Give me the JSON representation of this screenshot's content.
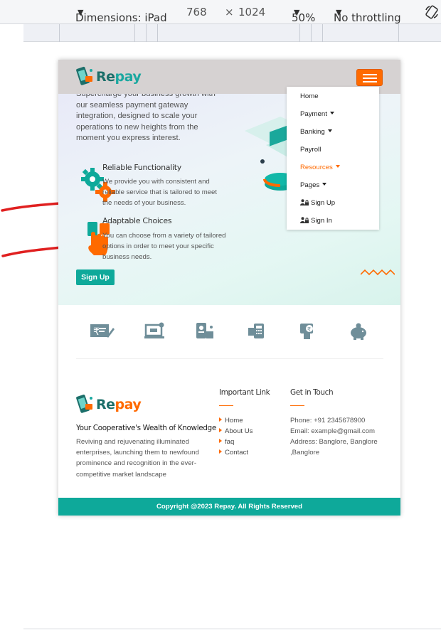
{
  "devtools": {
    "device_label": "Dimensions: iPad",
    "width": "768",
    "times": "×",
    "height": "1024",
    "zoom": "50%",
    "throttling": "No throttling"
  },
  "site": {
    "brand_prefix": "Re",
    "brand_suffix": "pay",
    "hero_text": "Supercharge your business growth with our seamless payment gateway integration, designed to scale your operations to new heights from the moment you express interest.",
    "features": [
      {
        "title": "Reliable Functionality",
        "desc": "We provide you with consistent and reliable service that is tailored to meet the needs of your business."
      },
      {
        "title": "Adaptable Choices",
        "desc": "You can choose from a variety of tailored options in order to meet your specific business needs."
      }
    ],
    "signup_label": "Sign Up"
  },
  "dropdown": {
    "items": [
      {
        "label": "Home",
        "caret": false,
        "active": false
      },
      {
        "label": "Payment",
        "caret": true,
        "active": false
      },
      {
        "label": "Banking",
        "caret": true,
        "active": false
      },
      {
        "label": "Payroll",
        "caret": false,
        "active": false
      },
      {
        "label": "Resources",
        "caret": true,
        "active": true
      },
      {
        "label": "Pages",
        "caret": true,
        "active": false
      },
      {
        "label": "Sign Up",
        "icon": "user-lock-icon"
      },
      {
        "label": "Sign In",
        "icon": "user-lock-icon"
      }
    ]
  },
  "icon_strip": [
    "rupee-card-icon",
    "laptop-payment-icon",
    "mobile-wallet-icon",
    "pos-terminal-icon",
    "phone-rupee-icon",
    "piggy-bank-icon"
  ],
  "footer": {
    "tagline": "Your Cooperative's Wealth of Knowledge",
    "description": "Reviving and rejuvenating illuminated enterprises, launching them to newfound prominence and recognition in the ever-competitive market landscape",
    "links_heading": "Important Link",
    "links": [
      "Home",
      "About Us",
      "faq",
      "Contact"
    ],
    "contact_heading": "Get in Touch",
    "contact": [
      "Phone: +91 2345678900",
      "Email: example@gmail.com",
      "Address: Banglore, Banglore",
      ",Banglore"
    ],
    "copyright": "Copyright @2023 Repay. All Rights Reserved"
  },
  "colors": {
    "accent": "#ff6a00",
    "brand_teal": "#0ea99a",
    "annotation": "#e02020"
  }
}
